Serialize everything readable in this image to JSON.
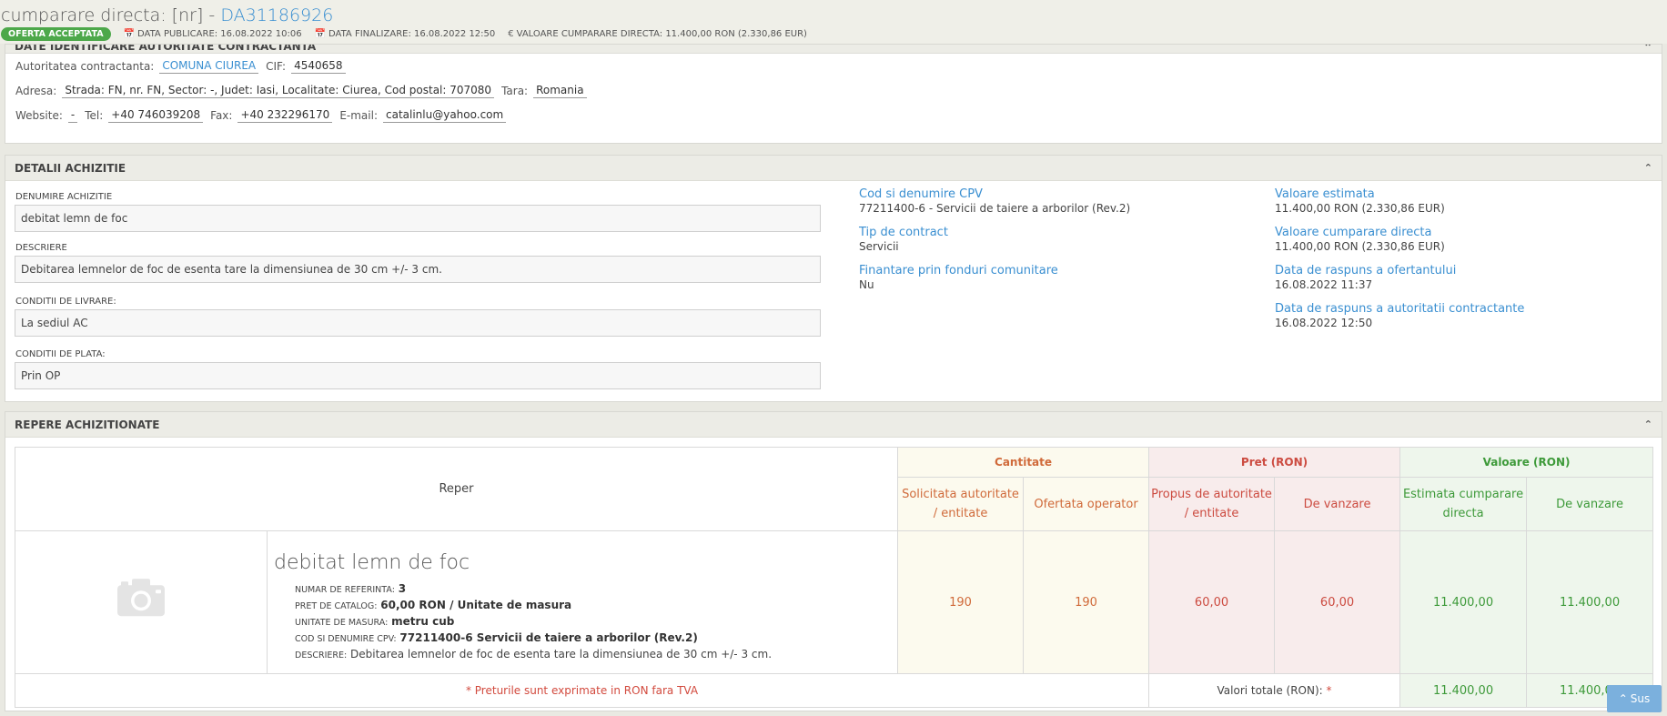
{
  "header": {
    "title_prefix": "cumparare directa: [nr] -",
    "code": "DA31186926",
    "status": "OFERTA ACCEPTATA",
    "meta": [
      {
        "icon": "calendar-icon",
        "label": "DATA PUBLICARE: 16.08.2022 10:06"
      },
      {
        "icon": "calendar-icon",
        "label": "DATA FINALIZARE: 16.08.2022 12:50"
      },
      {
        "icon": "euro-icon",
        "label": "VALOARE CUMPARARE DIRECTA: 11.400,00  RON (2.330,86  EUR)"
      }
    ]
  },
  "authority": {
    "cut_title": "DATE IDENTIFICARE AUTORITATE CONTRACTANTA",
    "labels": {
      "autoritate": "Autoritatea contractanta:",
      "cif": "CIF:",
      "adresa": "Adresa:",
      "tara": "Tara:",
      "website": "Website:",
      "tel": "Tel:",
      "fax": "Fax:",
      "email": "E-mail:"
    },
    "values": {
      "autoritate": "COMUNA CIUREA",
      "cif": "4540658",
      "adresa": "Strada: FN, nr. FN, Sector: -, Judet: Iasi, Localitate: Ciurea, Cod postal: 707080",
      "tara": "Romania",
      "website": "-",
      "tel": "+40 746039208",
      "fax": "+40 232296170",
      "email": "catalinlu@yahoo.com"
    }
  },
  "details": {
    "title": "DETALII ACHIZITIE",
    "fields": [
      {
        "label": "DENUMIRE ACHIZITIE",
        "value": "debitat lemn de foc"
      },
      {
        "label": "DESCRIERE",
        "value": "Debitarea lemnelor de foc de esenta tare la dimensiunea de 30 cm +/- 3 cm."
      },
      {
        "label": "CONDITII DE LIVRARE:",
        "value": "La sediul AC"
      },
      {
        "label": "CONDITII DE PLATA:",
        "value": "Prin OP"
      }
    ],
    "col2": [
      {
        "key": "Cod si denumire CPV",
        "value": "77211400-6 - Servicii de taiere a arborilor (Rev.2)"
      },
      {
        "key": "Tip de contract",
        "value": "Servicii"
      },
      {
        "key": "Finantare prin fonduri comunitare",
        "value": "Nu"
      }
    ],
    "col3": [
      {
        "key": "Valoare estimata",
        "value": "11.400,00  RON (2.330,86  EUR)"
      },
      {
        "key": "Valoare cumparare directa",
        "value": "11.400,00  RON (2.330,86  EUR)"
      },
      {
        "key": "Data de raspuns a ofertantului",
        "value": "16.08.2022 11:37"
      },
      {
        "key": "Data de raspuns a autoritatii contractante",
        "value": "16.08.2022 12:50"
      }
    ]
  },
  "items": {
    "title": "REPERE ACHIZITIONATE",
    "headers": {
      "reper": "Reper",
      "cantitate": "Cantitate",
      "pret": "Pret (RON)",
      "valoare": "Valoare (RON)",
      "solicitata": "Solicitata autoritate / entitate",
      "ofertata": "Ofertata operator",
      "propus": "Propus de autoritate / entitate",
      "de_vanzare_pret": "De vanzare",
      "estimata": "Estimata cumparare directa",
      "de_vanzare_val": "De vanzare"
    },
    "row": {
      "title": "debitat lemn de foc",
      "specs": [
        {
          "key": "NUMAR DE REFERINTA:",
          "value": "3",
          "bold": true
        },
        {
          "key": "PRET DE CATALOG:",
          "value": "60,00  RON / Unitate de masura",
          "bold": true
        },
        {
          "key": "UNITATE DE MASURA:",
          "value": "metru cub",
          "bold": true
        },
        {
          "key": "COD SI DENUMIRE CPV:",
          "value": "77211400-6 Servicii de taiere a arborilor (Rev.2)",
          "bold": true
        },
        {
          "key": "DESCRIERE:",
          "value": "Debitarea lemnelor de foc de esenta tare la dimensiunea de 30 cm +/- 3 cm.",
          "bold": false
        }
      ],
      "solicitata": "190",
      "ofertata": "190",
      "propus": "60,00",
      "de_vanzare_pret": "60,00",
      "estimata": "11.400,00",
      "de_vanzare_val": "11.400,00"
    },
    "footer": {
      "note": "* Preturile sunt exprimate in RON fara TVA",
      "totals_label": "Valori totale (RON):",
      "totals_star": "*",
      "total_estimata": "11.400,00",
      "total_vanzare": "11.400,00"
    }
  },
  "scroll_top": {
    "label": "Sus",
    "icon": "chevron-up-icon"
  }
}
